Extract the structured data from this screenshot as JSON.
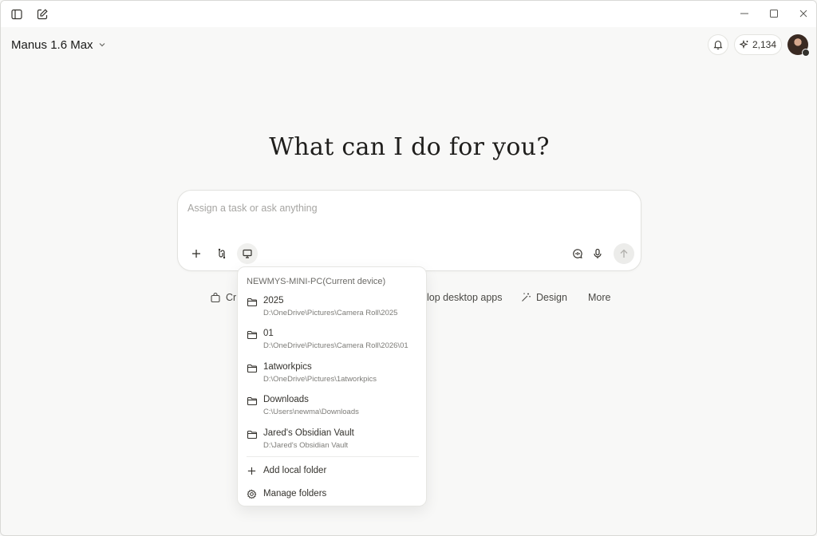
{
  "header": {
    "model_label": "Manus 1.6 Max",
    "credits": "2,134"
  },
  "hero": {
    "title": "What can I do for you?"
  },
  "composer": {
    "placeholder": "Assign a task or ask anything"
  },
  "chips": [
    {
      "label": "Cr",
      "icon": "bag-icon"
    },
    {
      "label": "lop desktop apps",
      "icon": ""
    },
    {
      "label": "Design",
      "icon": "wand-icon"
    },
    {
      "label": "More",
      "icon": ""
    }
  ],
  "dropdown": {
    "header": "NEWMYS-MINI-PC(Current device)",
    "folders": [
      {
        "name": "2025",
        "path": "D:\\OneDrive\\Pictures\\Camera Roll\\2025"
      },
      {
        "name": "01",
        "path": "D:\\OneDrive\\Pictures\\Camera Roll\\2026\\01"
      },
      {
        "name": "1atworkpics",
        "path": "D:\\OneDrive\\Pictures\\1atworkpics"
      },
      {
        "name": "Downloads",
        "path": "C:\\Users\\newma\\Downloads"
      },
      {
        "name": "Jared's Obsidian Vault",
        "path": "D:\\Jared's Obsidian Vault"
      }
    ],
    "actions": {
      "add": "Add local folder",
      "manage": "Manage folders"
    }
  }
}
